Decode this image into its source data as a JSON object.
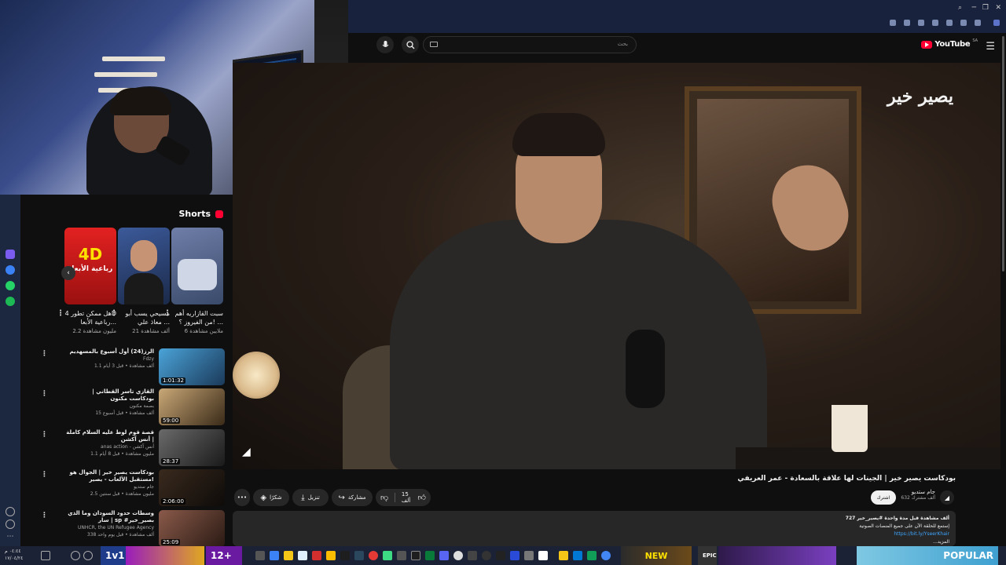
{
  "browser": {
    "toolbar_icons": [
      "search-icon",
      "minimize-icon",
      "fullscreen-icon",
      "menu-icon",
      "close-icon"
    ]
  },
  "youtube": {
    "logo_text": "YouTube",
    "country_code": "SA",
    "search_placeholder": "بحث",
    "search_icon": "search-icon",
    "mic_icon": "microphone-icon"
  },
  "shorts": {
    "section_title": "Shorts",
    "items": [
      {
        "title": "سبت القازاريه أهم من الفيروز ؟! ...",
        "views": "6 ملايين مشاهدة"
      },
      {
        "title": "مسيحي يسب أبو معاذ علي ...",
        "views": "21 ألف مشاهدة"
      },
      {
        "title": "هل ممكن تطور 4D رباعية الأبعا...",
        "views": "2.2 مليون مشاهدة"
      }
    ],
    "thumb_texts": [
      "4D",
      "رباعية الأبعاد"
    ]
  },
  "related": [
    {
      "title": "الرز(24) أول أسبوع بالمسهديم",
      "channel": "Fdzy",
      "meta": "1.1 ألف مشاهدة • قبل 3 أيام",
      "duration": "1:01:32"
    },
    {
      "title": "القازي تاسر القطاني | بودكاست مكنون",
      "channel": "بصمة مكنون",
      "meta": "15 ألف مشاهدة • قبل أسبوع",
      "duration": "59:00"
    },
    {
      "title": "قصة قوم لوط عليه السلام كاملة | أنس آكشن",
      "channel": "anas action - أنس آكشن",
      "meta": "1.1 مليون مشاهدة • قبل 8 أيام",
      "duration": "28:37"
    },
    {
      "title": "بودكاست يصير خير | الجوال هو مستقبل الألعاب - يصير!",
      "channel": "جام ستديو",
      "meta": "2.5 مليون مشاهدة • قبل سنتين",
      "duration": "2:06:00"
    },
    {
      "title": "وسطات حدود السودان وما الذي سار | sp #بصير_خير",
      "channel": "UNHCR, the UN Refugee Agency",
      "meta": "338 ألف مشاهدة • قبل يوم واحد",
      "duration": "25:09"
    }
  ],
  "video": {
    "title": "بودكاست يصير خير | الجينات لها علاقة بالسعادة - عمر العريفي",
    "brand_overlay": "يصير خير",
    "channel_name": "جام ستديو",
    "channel_subs": "632 ألف مشترك",
    "join_label": "اشترك",
    "like_count": "15 ألف",
    "share_label": "مشاركة",
    "download_label": "تنزيل",
    "thanks_label": "شكرًا",
    "more_label": "•••"
  },
  "description": {
    "stats": "727 ألف مشاهدة قبل مدة واحدة  #يصير_خير",
    "line2": "إستمع للحلقة الآن على جميع المنصات الصوتية",
    "link": "https://bit.ly/YseerKhair",
    "more": "...المزيد"
  },
  "taskbar": {
    "clock_time": "٠٤:٤٤ م",
    "clock_date": "١٧/٠٤/٢٤",
    "banners": [
      "1v1",
      "12+",
      "NEW",
      "EPIC",
      "POPULAR"
    ]
  },
  "colors": {
    "yt_red": "#ff0033",
    "bg": "#0f0f0f",
    "chip": "#272727",
    "taskbar": "#1b2235"
  }
}
